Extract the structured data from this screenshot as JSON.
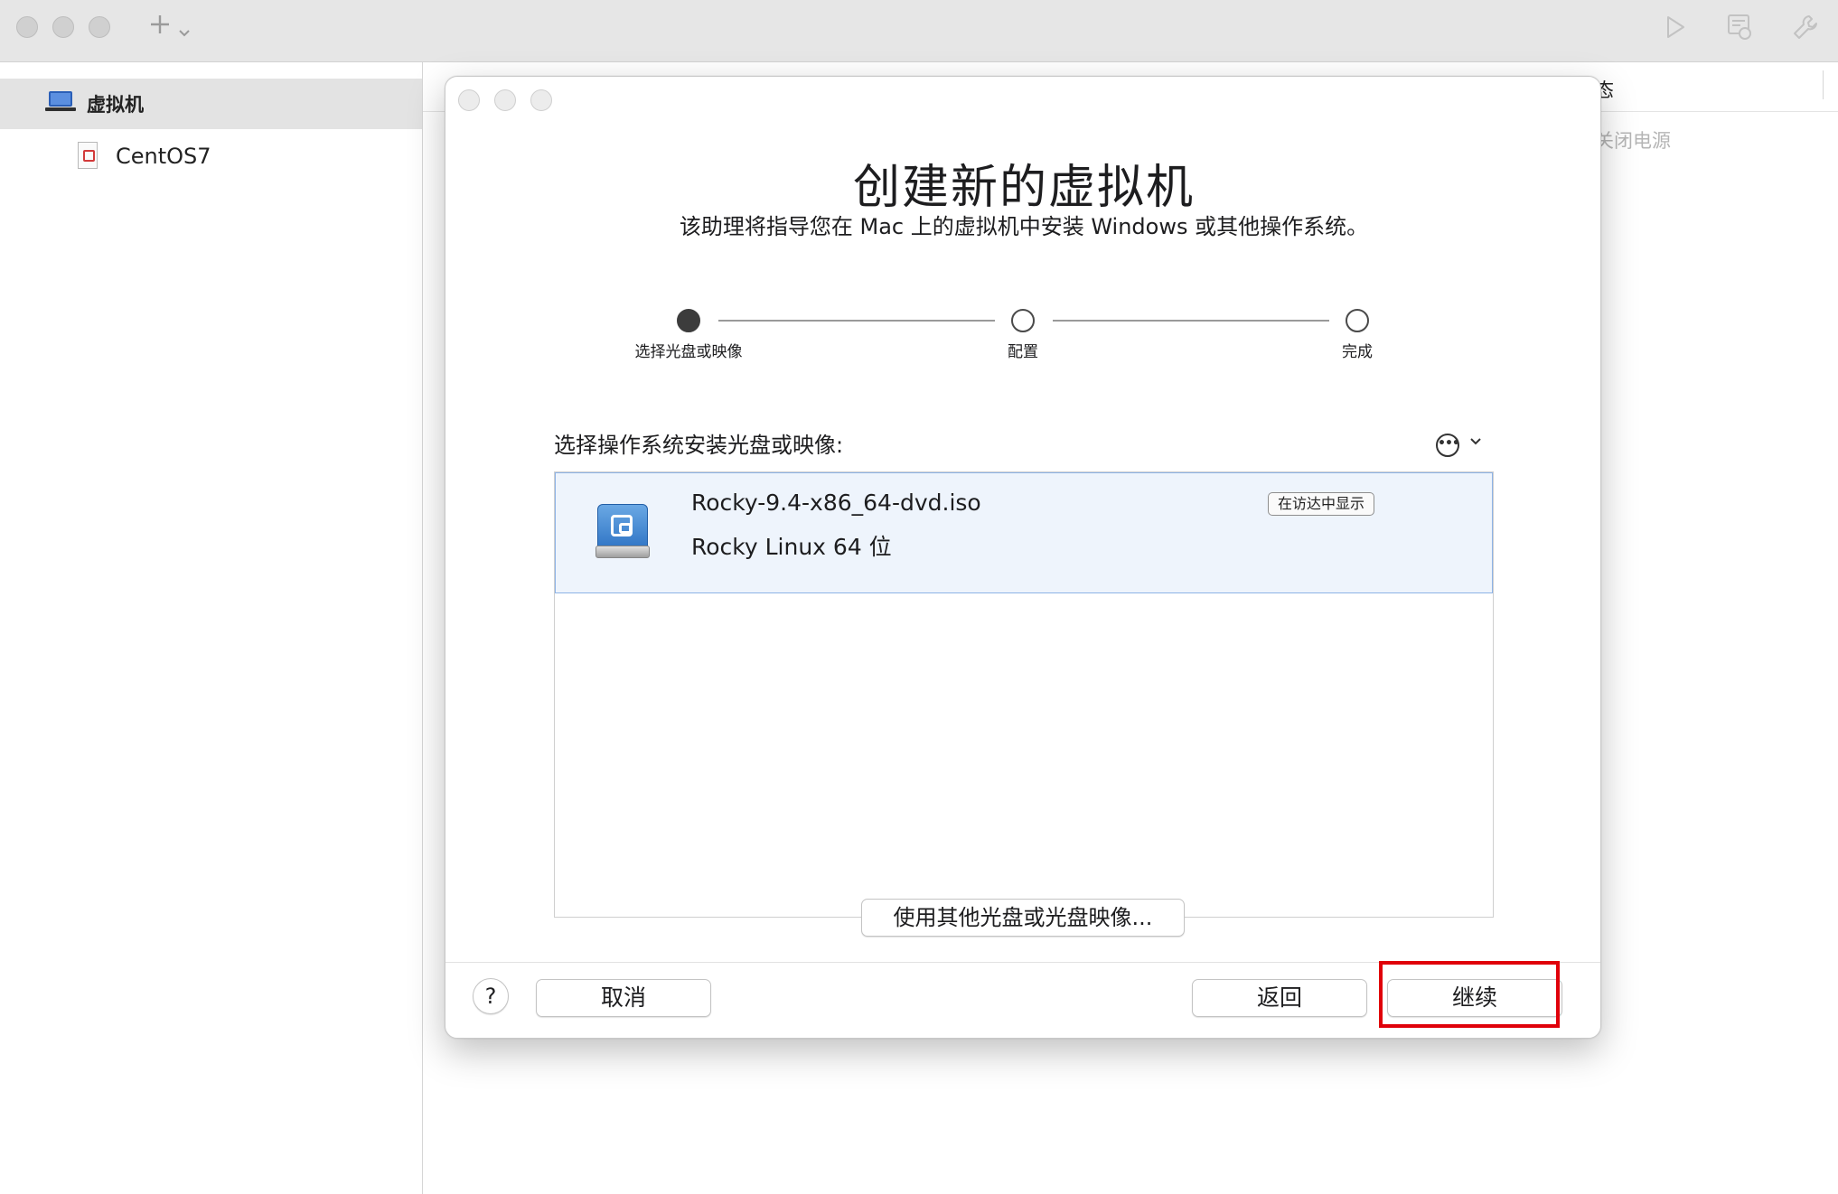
{
  "toolbar": {
    "add_icon": "plus-icon",
    "add_chevron_icon": "chevron-down-icon",
    "play_icon": "play-icon",
    "snapshot_icon": "snapshot-icon",
    "settings_icon": "wrench-icon"
  },
  "sidebar": {
    "section_label": "虚拟机",
    "items": [
      {
        "label": "CentOS7"
      }
    ]
  },
  "right_pane": {
    "status_header": "态",
    "power_state": "关闭电源"
  },
  "dialog": {
    "title": "创建新的虚拟机",
    "subtitle": "该助理将指导您在 Mac 上的虚拟机中安装 Windows 或其他操作系统。",
    "steps": [
      {
        "label": "选择光盘或映像",
        "active": true
      },
      {
        "label": "配置",
        "active": false
      },
      {
        "label": "完成",
        "active": false
      }
    ],
    "list_heading": "选择操作系统安装光盘或映像:",
    "images": [
      {
        "name": "Rocky-9.4-x86_64-dvd.iso",
        "os": "Rocky Linux 64 位",
        "finder_label": "在访达中显示",
        "selected": true
      }
    ],
    "other_disc_button": "使用其他光盘或光盘映像...",
    "help_label": "?",
    "cancel_label": "取消",
    "back_label": "返回",
    "continue_label": "继续"
  },
  "colors": {
    "highlight": "#e0000a",
    "selected_row": "#eef4fc",
    "selected_row_border": "#8db3e6"
  }
}
